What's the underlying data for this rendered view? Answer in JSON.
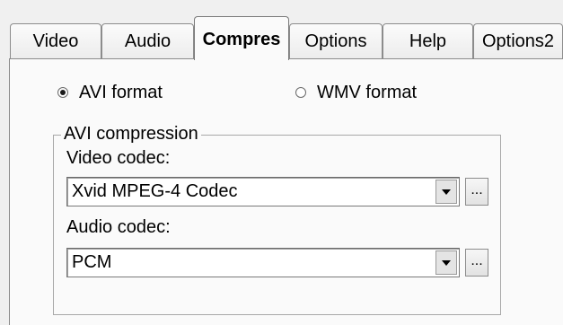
{
  "tabs": [
    {
      "label": "Video",
      "active": false
    },
    {
      "label": "Audio",
      "active": false
    },
    {
      "label": "Compres",
      "active": true
    },
    {
      "label": "Options",
      "active": false
    },
    {
      "label": "Help",
      "active": false
    },
    {
      "label": "Options2",
      "active": false
    }
  ],
  "format": {
    "avi_label": "AVI format",
    "avi_selected": true,
    "wmv_label": "WMV format",
    "wmv_selected": false
  },
  "avi_compression": {
    "group_title": "AVI compression",
    "video_codec_label": "Video codec:",
    "video_codec_value": "Xvid MPEG-4 Codec",
    "audio_codec_label": "Audio codec:",
    "audio_codec_value": "PCM",
    "browse_button_label": "..."
  }
}
